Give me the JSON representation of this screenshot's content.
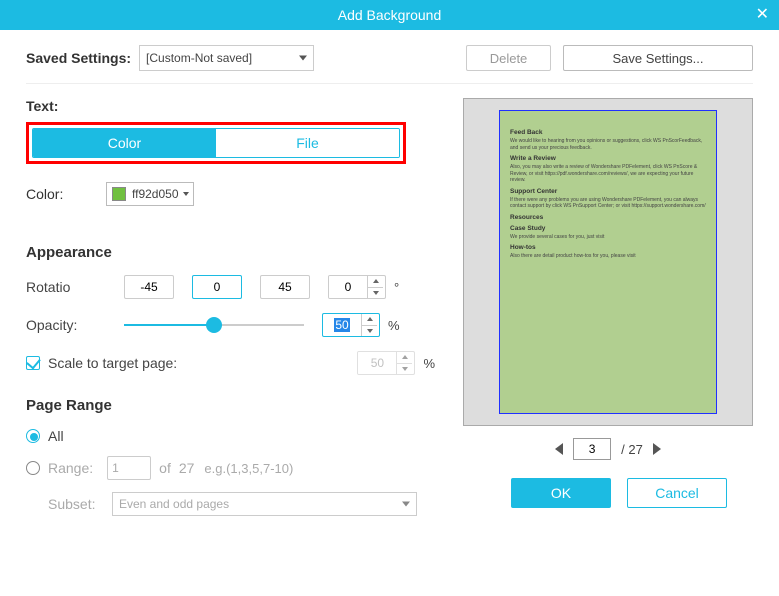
{
  "titlebar": {
    "title": "Add Background"
  },
  "saved": {
    "label": "Saved Settings:",
    "value": "[Custom-Not saved]",
    "delete": "Delete",
    "save": "Save Settings..."
  },
  "text": {
    "label": "Text:",
    "tab_color": "Color",
    "tab_file": "File"
  },
  "color": {
    "label": "Color:",
    "value": "ff92d050"
  },
  "appearance": {
    "title": "Appearance",
    "rotation_label": "Rotatio",
    "rot_neg": "-45",
    "rot_zero": "0",
    "rot_pos": "45",
    "rot_spin": "0",
    "deg": "°",
    "opacity_label": "Opacity:",
    "opacity_value": "50",
    "pct": "%",
    "scale_label": "Scale to target page:",
    "scale_value": "50"
  },
  "pagerange": {
    "title": "Page Range",
    "all": "All",
    "range": "Range:",
    "from": "1",
    "of": "of",
    "total": "27",
    "hint": "e.g.(1,3,5,7-10)",
    "subset_label": "Subset:",
    "subset_value": "Even and odd pages"
  },
  "preview": {
    "current_page": "3",
    "sep": "/",
    "total_pages": "27",
    "doc": {
      "h1": "Feed Back",
      "t1": "We would like to hearing from you opinions or suggestions, click WS PnScorFeedback, and send us your precious feedback.",
      "h2": "Write a Review",
      "t2": "Also, you may also write a review of Wondershare PDFelement, click WS PnScore & Review, or visit https://pdf.wondershare.com/reviews/, we are expecting your future review.",
      "h3": "Support Center",
      "t3": "If there were any problems you are using Wondershare PDFelement, you can always contact support by click WS PnSupport Center; or visit https://support.wondershare.com/",
      "h4": "Resources",
      "h5": "Case Study",
      "t5": "We provide several cases for you, just visit",
      "h6": "How-tos",
      "t6": "Also there are detail product how-tos for you, please visit"
    }
  },
  "footer": {
    "ok": "OK",
    "cancel": "Cancel"
  }
}
